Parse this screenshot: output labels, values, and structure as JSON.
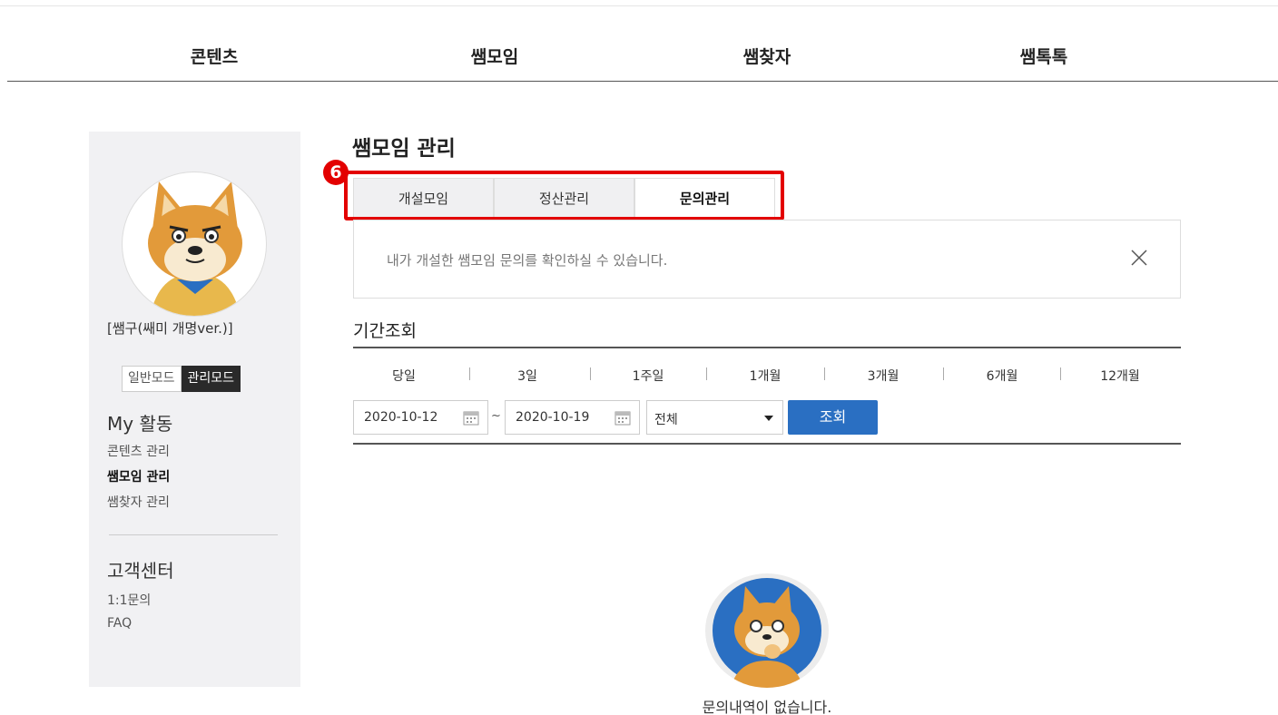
{
  "gnb": {
    "items": [
      {
        "label": "콘텐츠"
      },
      {
        "label": "쌤모임"
      },
      {
        "label": "쌤찾자"
      },
      {
        "label": "쌤톡톡"
      }
    ]
  },
  "sidebar": {
    "nickname": "[쌤구(쌔미 개명ver.)]",
    "mode_normal": "일반모드",
    "mode_admin": "관리모드",
    "my_title": "My 활동",
    "my_items": [
      "콘텐츠 관리",
      "쌤모임 관리",
      "쌤찾자 관리"
    ],
    "cs_title": "고객센터",
    "cs_items": [
      "1:1문의",
      "FAQ"
    ]
  },
  "main": {
    "title": "쌤모임 관리",
    "badge": "6",
    "tabs": [
      "개설모임",
      "정산관리",
      "문의관리"
    ],
    "notice": "내가 개설한 쌤모임 문의를 확인하실 수 있습니다.",
    "period_title": "기간조회",
    "ranges": [
      "당일",
      "3일",
      "1주일",
      "1개월",
      "3개월",
      "6개월",
      "12개월"
    ],
    "date_from": "2020-10-12",
    "date_to": "2020-10-19",
    "tilde": "~",
    "filter_value": "전체",
    "search_label": "조회",
    "empty_message": "문의내역이 없습니다."
  },
  "colors": {
    "accent_blue": "#2a6fc2",
    "highlight_red": "#e30000",
    "sidebar_bg": "#f1f1f3"
  }
}
